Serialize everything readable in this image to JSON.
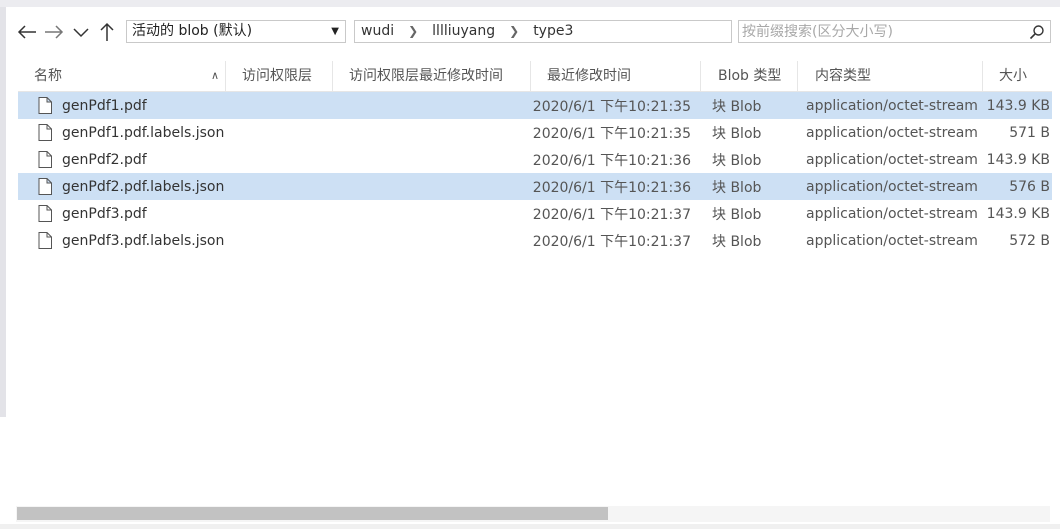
{
  "toolbar": {
    "back_icon": "arrow-left-icon",
    "forward_icon": "arrow-right-icon",
    "recent_icon": "chevron-down-icon",
    "up_icon": "arrow-up-icon",
    "blob_select_value": "活动的 blob (默认)",
    "breadcrumb": [
      "wudi",
      "lllliuyang",
      "type3"
    ],
    "search_placeholder": "按前缀搜索(区分大小写)",
    "search_icon": "search-icon"
  },
  "columns": {
    "name": "名称",
    "access_tier": "访问权限层",
    "access_tier_modified": "访问权限层最近修改时间",
    "last_modified": "最近修改时间",
    "blob_type": "Blob 类型",
    "content_type": "内容类型",
    "size": "大小"
  },
  "rows": [
    {
      "name": "genPdf1.pdf",
      "access_tier": "",
      "access_tier_modified": "",
      "last_modified": "2020/6/1 下午10:21:35",
      "blob_type": "块 Blob",
      "content_type": "application/octet-stream",
      "size": "143.9 KB",
      "selected": true
    },
    {
      "name": "genPdf1.pdf.labels.json",
      "access_tier": "",
      "access_tier_modified": "",
      "last_modified": "2020/6/1 下午10:21:35",
      "blob_type": "块 Blob",
      "content_type": "application/octet-stream",
      "size": "571 B",
      "selected": false
    },
    {
      "name": "genPdf2.pdf",
      "access_tier": "",
      "access_tier_modified": "",
      "last_modified": "2020/6/1 下午10:21:36",
      "blob_type": "块 Blob",
      "content_type": "application/octet-stream",
      "size": "143.9 KB",
      "selected": false
    },
    {
      "name": "genPdf2.pdf.labels.json",
      "access_tier": "",
      "access_tier_modified": "",
      "last_modified": "2020/6/1 下午10:21:36",
      "blob_type": "块 Blob",
      "content_type": "application/octet-stream",
      "size": "576 B",
      "selected": true
    },
    {
      "name": "genPdf3.pdf",
      "access_tier": "",
      "access_tier_modified": "",
      "last_modified": "2020/6/1 下午10:21:37",
      "blob_type": "块 Blob",
      "content_type": "application/octet-stream",
      "size": "143.9 KB",
      "selected": false
    },
    {
      "name": "genPdf3.pdf.labels.json",
      "access_tier": "",
      "access_tier_modified": "",
      "last_modified": "2020/6/1 下午10:21:37",
      "blob_type": "块 Blob",
      "content_type": "application/octet-stream",
      "size": "572 B",
      "selected": false
    }
  ],
  "colors": {
    "selected_row": "#cde0f4",
    "scroll_thumb": "#c2c2c2"
  }
}
